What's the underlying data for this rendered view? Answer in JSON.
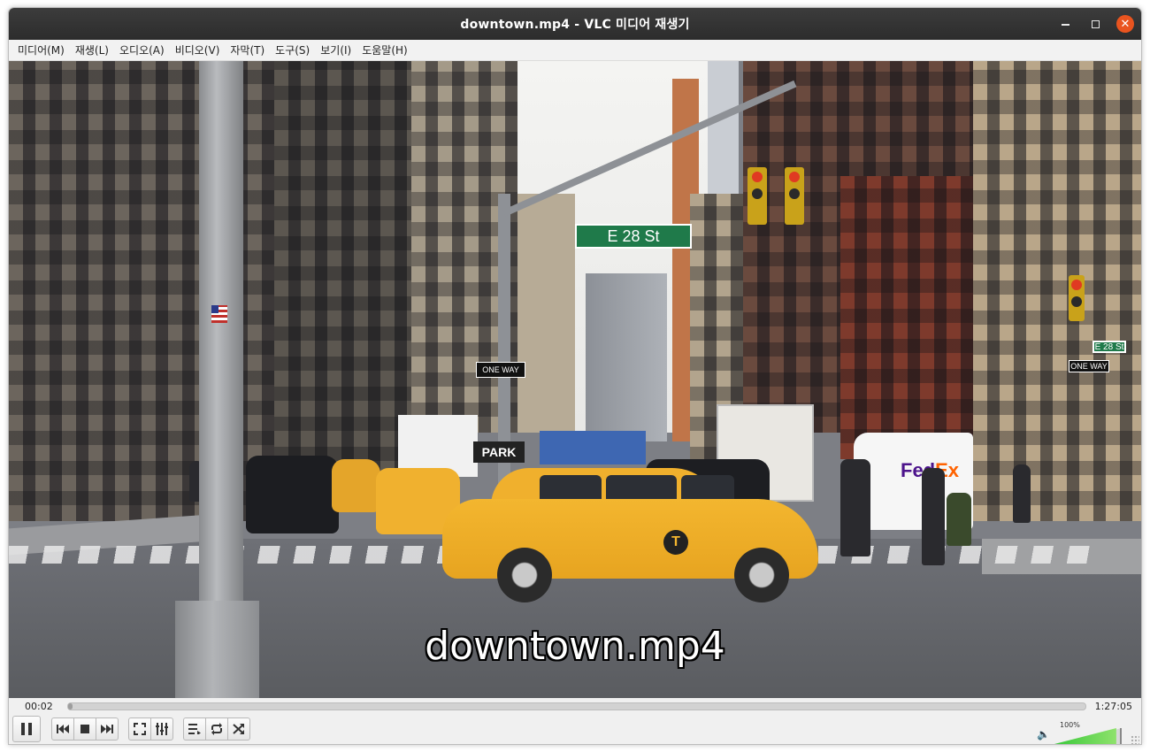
{
  "window": {
    "title": "downtown.mp4 - VLC 미디어 재생기",
    "close_icon": "close-icon",
    "minimize_icon": "minimize-icon",
    "maximize_icon": "maximize-icon"
  },
  "menu": {
    "items": [
      {
        "label": "미디어(M)"
      },
      {
        "label": "재생(L)"
      },
      {
        "label": "오디오(A)"
      },
      {
        "label": "비디오(V)"
      },
      {
        "label": "자막(T)"
      },
      {
        "label": "도구(S)"
      },
      {
        "label": "보기(I)"
      },
      {
        "label": "도움말(H)"
      }
    ]
  },
  "video": {
    "subtitle": "downtown.mp4",
    "street_sign": "E 28 St",
    "street_sign_small": "E 28 St",
    "one_way": "ONE WAY",
    "park_sign": "PARK",
    "taxi_badge": "T",
    "fedex_fed": "Fed",
    "fedex_ex": "Ex"
  },
  "playback": {
    "elapsed": "00:02",
    "total": "1:27:05",
    "progress": 0.0004
  },
  "buttons": {
    "pause_icon": "pause-icon",
    "prev_icon": "skip-previous-icon",
    "stop_icon": "stop-icon",
    "next_icon": "skip-next-icon",
    "fullscreen_icon": "fullscreen-icon",
    "extended_icon": "equalizer-icon",
    "playlist_icon": "playlist-icon",
    "loop_icon": "loop-icon",
    "shuffle_icon": "shuffle-icon"
  },
  "volume": {
    "label": "100%",
    "level": 1.0,
    "icon": "speaker-icon"
  },
  "colors": {
    "titlebar": "#2f2f2f",
    "close": "#e9541f",
    "volume_fill": "#38c83a",
    "taxi": "#f3b62f"
  }
}
